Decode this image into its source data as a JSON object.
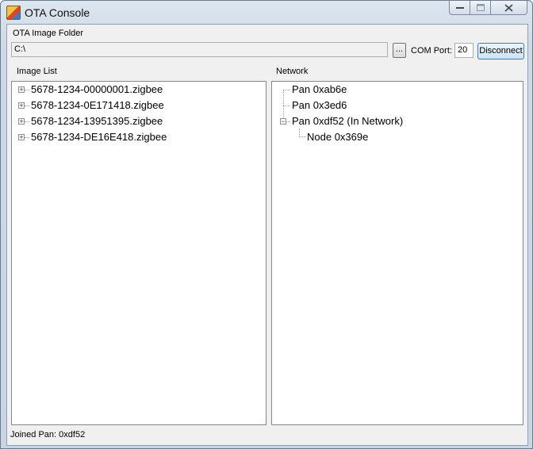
{
  "window": {
    "title": "OTA Console",
    "controls": [
      "minimize",
      "maximize",
      "close"
    ]
  },
  "folder": {
    "label": "OTA Image Folder",
    "value": "C:\\",
    "browse_label": "..."
  },
  "com": {
    "label": "COM Port:",
    "value": "20"
  },
  "disconnect_label": "Disconnect",
  "image_list": {
    "label": "Image List",
    "items": [
      "5678-1234-00000001.zigbee",
      "5678-1234-0E171418.zigbee",
      "5678-1234-13951395.zigbee",
      "5678-1234-DE16E418.zigbee"
    ]
  },
  "network": {
    "label": "Network",
    "pans": [
      {
        "label": "Pan 0xab6e"
      },
      {
        "label": "Pan 0x3ed6"
      },
      {
        "label": "Pan 0xdf52 (In Network)",
        "expanded": true,
        "children": [
          "Node 0x369e"
        ]
      }
    ]
  },
  "status": {
    "text": "Joined Pan: 0xdf52"
  }
}
